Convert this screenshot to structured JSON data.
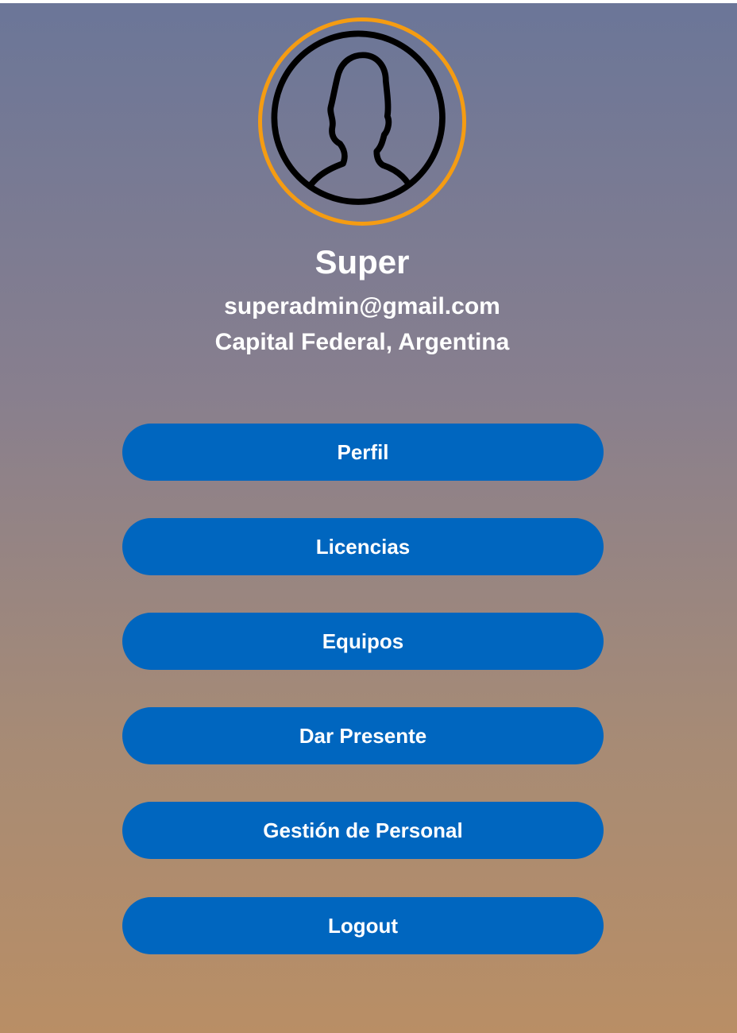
{
  "user": {
    "name": "Super",
    "email": "superadmin@gmail.com",
    "location": "Capital Federal, Argentina",
    "avatar_icon": "user-silhouette-icon"
  },
  "menu": {
    "items": [
      {
        "label": "Perfil"
      },
      {
        "label": "Licencias"
      },
      {
        "label": "Equipos"
      },
      {
        "label": "Dar Presente"
      },
      {
        "label": "Gestión de Personal"
      },
      {
        "label": "Logout"
      }
    ]
  },
  "colors": {
    "accent_ring": "#f59c12",
    "button_bg": "#0066bf",
    "gradient_top": "#6b7698",
    "gradient_bottom": "#b98e65"
  }
}
